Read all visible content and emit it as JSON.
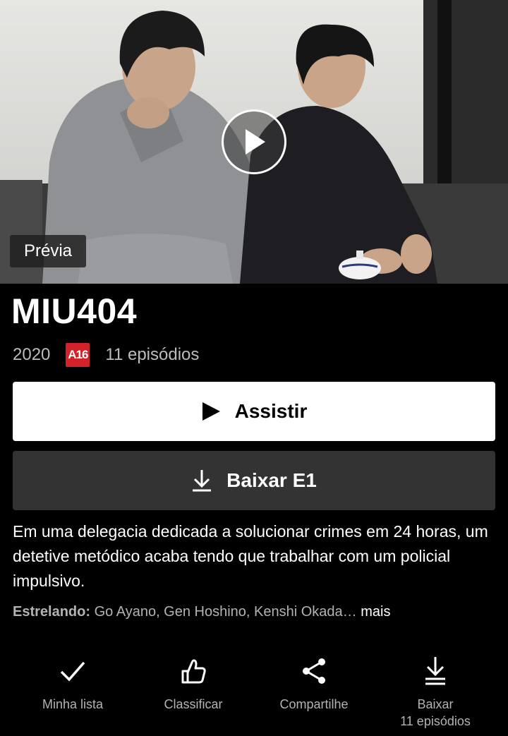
{
  "hero": {
    "preview_label": "Prévia",
    "play_icon": "play-circle-icon"
  },
  "show": {
    "title": "MIU404",
    "year": "2020",
    "rating": "A16",
    "rating_color": "#d2232a",
    "episodes": "11 episódios"
  },
  "buttons": {
    "play_label": "Assistir",
    "download_label": "Baixar E1"
  },
  "description": "Em uma delegacia dedicada a solucionar crimes em 24 horas, um detetive metódico acaba tendo que trabalhar com um policial impulsivo.",
  "cast": {
    "label": "Estrelando:",
    "names": " Go Ayano, Gen Hoshino, Kenshi Okada… ",
    "more": "mais"
  },
  "actions": [
    {
      "icon": "check-icon",
      "label": "Minha lista"
    },
    {
      "icon": "thumbs-up-icon",
      "label": "Classificar"
    },
    {
      "icon": "share-icon",
      "label": "Compartilhe"
    },
    {
      "icon": "download-icon",
      "label": "Baixar",
      "sublabel": "11 episódios"
    }
  ]
}
